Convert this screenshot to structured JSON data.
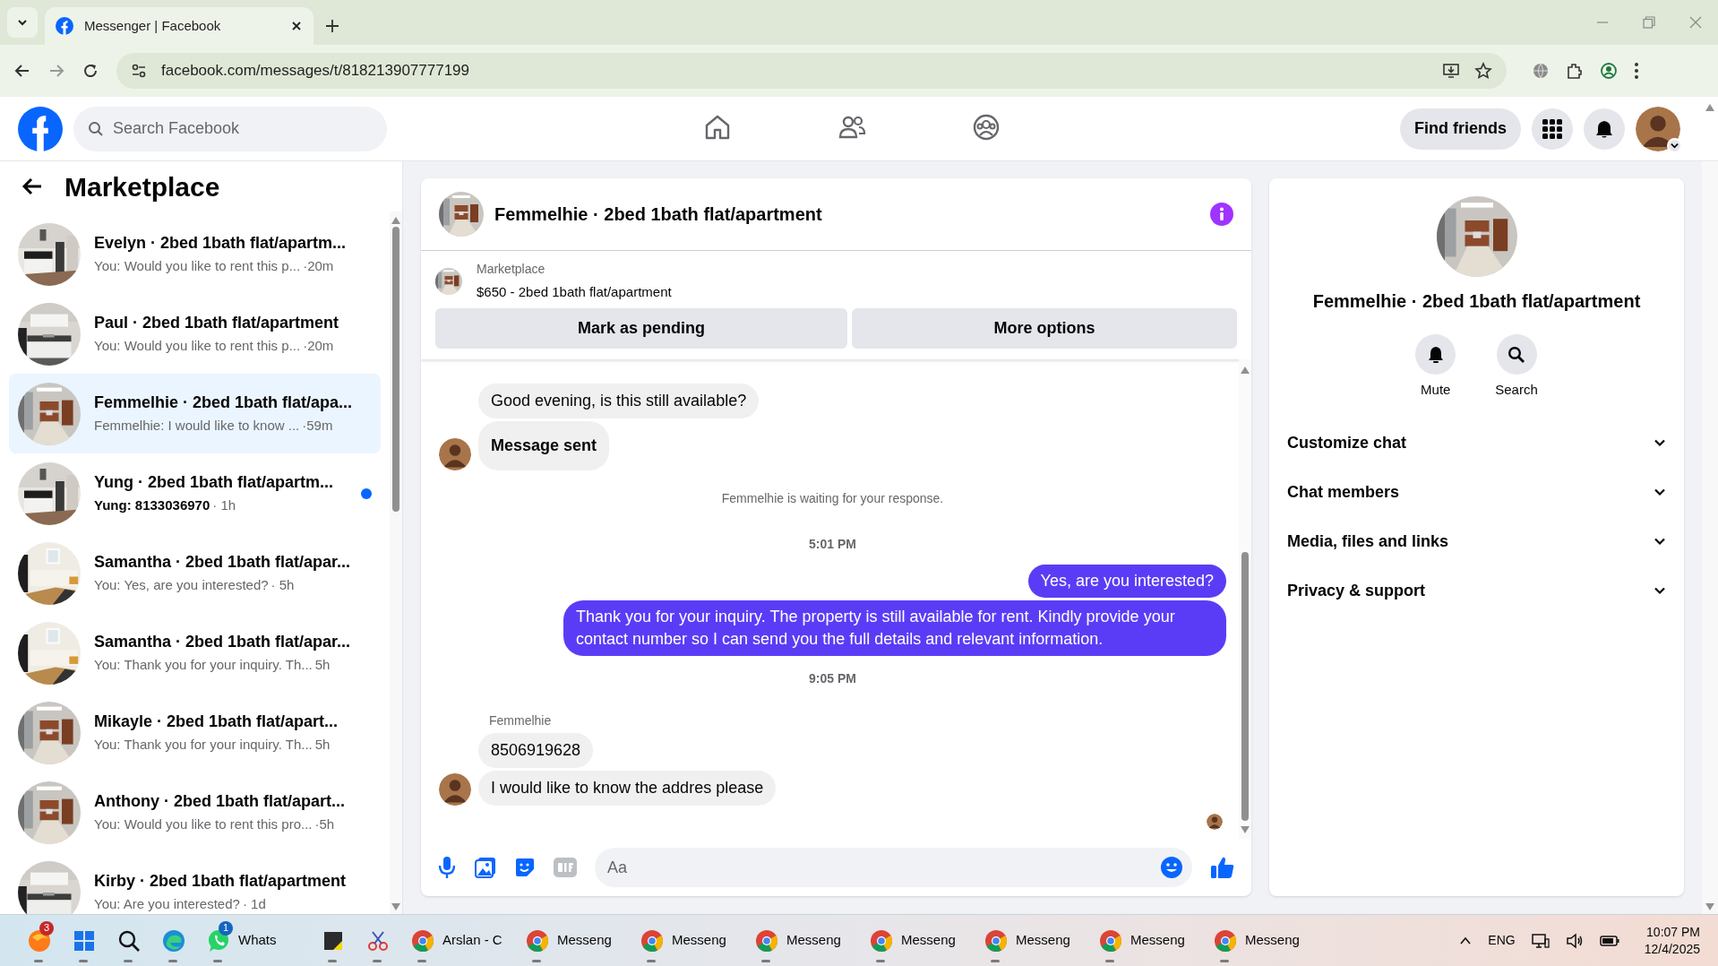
{
  "browser": {
    "tab_title": "Messenger | Facebook",
    "url": "facebook.com/messages/t/818213907777199"
  },
  "topbar": {
    "search_placeholder": "Search Facebook",
    "find_friends": "Find friends"
  },
  "sidebar": {
    "title": "Marketplace",
    "conversations": [
      {
        "title": "Evelyn · 2bed 1bath flat/apartm...",
        "preview": "You: Would you like to rent this p...",
        "time": "·20m",
        "unread": false,
        "selected": false
      },
      {
        "title": "Paul · 2bed 1bath flat/apartment",
        "preview": "You: Would you like to rent this p...",
        "time": "·20m",
        "unread": false,
        "selected": false
      },
      {
        "title": "Femmelhie · 2bed 1bath flat/apa...",
        "preview": "Femmelhie: I would like to know ...",
        "time": "·59m",
        "unread": false,
        "selected": true
      },
      {
        "title": "Yung · 2bed 1bath flat/apartm...",
        "preview": "Yung: 8133036970",
        "time": "· 1h",
        "unread": true,
        "selected": false
      },
      {
        "title": "Samantha · 2bed 1bath flat/apar...",
        "preview": "You: Yes, are you interested?",
        "time": "· 5h",
        "unread": false,
        "selected": false
      },
      {
        "title": "Samantha · 2bed 1bath flat/apar...",
        "preview": "You: Thank you for your inquiry. Th...",
        "time": "5h",
        "unread": false,
        "selected": false
      },
      {
        "title": "Mikayle · 2bed 1bath flat/apart...",
        "preview": "You: Thank you for your inquiry. Th...",
        "time": "5h",
        "unread": false,
        "selected": false
      },
      {
        "title": "Anthony · 2bed 1bath flat/apart...",
        "preview": "You: Would you like to rent this pro...",
        "time": "·5h",
        "unread": false,
        "selected": false
      },
      {
        "title": "Kirby · 2bed 1bath flat/apartment",
        "preview": "You: Are you interested?",
        "time": "· 1d",
        "unread": false,
        "selected": false
      }
    ]
  },
  "chat": {
    "title": "Femmelhie · 2bed 1bath flat/apartment",
    "listing": {
      "label": "Marketplace",
      "title": "$650 - 2bed 1bath flat/apartment"
    },
    "buttons": [
      "Mark as pending",
      "More options"
    ],
    "messages": [
      {
        "kind": "incoming",
        "text": "Good evening, is this still available?",
        "bold": false,
        "avatar": false
      },
      {
        "kind": "incoming",
        "text": "Message sent",
        "bold": true,
        "avatar": true
      },
      {
        "kind": "notice",
        "text": "Femmelhie is waiting for your response."
      },
      {
        "kind": "timestamp",
        "text": "5:01 PM"
      },
      {
        "kind": "outgoing",
        "text": "Yes, are you interested?"
      },
      {
        "kind": "outgoing",
        "text": "Thank you for your inquiry. The property is still available for rent. Kindly provide your contact number so I can send you the full details and relevant information."
      },
      {
        "kind": "timestamp",
        "text": "9:05 PM"
      },
      {
        "kind": "sender",
        "text": "Femmelhie"
      },
      {
        "kind": "incoming",
        "text": "8506919628",
        "bold": false,
        "avatar": false
      },
      {
        "kind": "incoming",
        "text": "I would like to know the addres please",
        "bold": false,
        "avatar": true
      }
    ],
    "seen": true,
    "composer": {
      "placeholder": "Aa"
    }
  },
  "details": {
    "title": "Femmelhie · 2bed 1bath flat/apartment",
    "actions": [
      {
        "kind": "mute",
        "label": "Mute"
      },
      {
        "kind": "search",
        "label": "Search"
      }
    ],
    "sections": [
      "Customize chat",
      "Chat members",
      "Media, files and links",
      "Privacy & support"
    ]
  },
  "taskbar": {
    "items": [
      {
        "kind": "browser-fox",
        "badge": "3"
      },
      {
        "kind": "start"
      },
      {
        "kind": "search"
      },
      {
        "kind": "edge"
      },
      {
        "kind": "chat-app",
        "label": "Whats",
        "badge": "1"
      },
      {
        "kind": "notes"
      },
      {
        "kind": "snip"
      },
      {
        "kind": "chrome",
        "label": "Arslan - C"
      },
      {
        "kind": "chrome",
        "label": "Messeng"
      },
      {
        "kind": "chrome",
        "label": "Messeng"
      },
      {
        "kind": "chrome",
        "label": "Messeng"
      },
      {
        "kind": "chrome",
        "label": "Messeng"
      },
      {
        "kind": "chrome",
        "label": "Messeng"
      },
      {
        "kind": "chrome",
        "label": "Messeng"
      },
      {
        "kind": "chrome",
        "label": "Messeng"
      }
    ],
    "language": "ENG",
    "time": "10:07 PM",
    "date": "12/4/2025"
  }
}
